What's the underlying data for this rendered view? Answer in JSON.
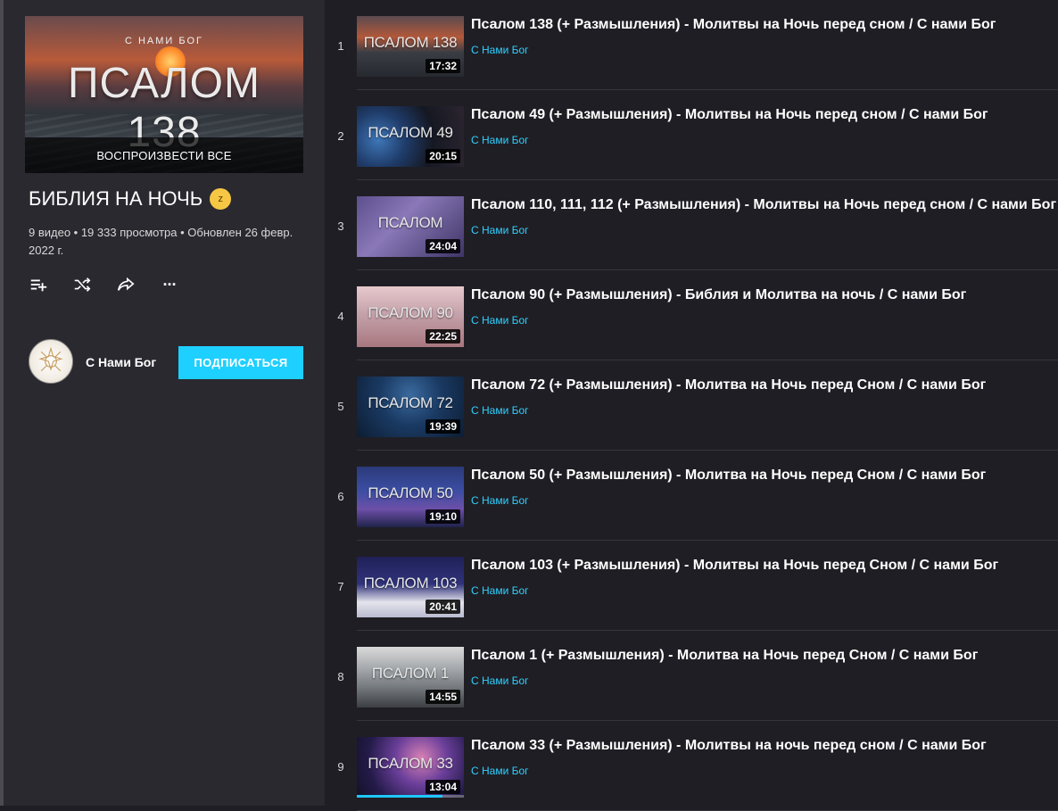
{
  "playlist": {
    "hero_brand": "С НАМИ БОГ",
    "hero_title": "ПСАЛОМ 138",
    "play_all_label": "ВОСПРОИЗВЕСТИ ВСЕ",
    "title": "БИБЛИЯ НА НОЧЬ",
    "title_emoji_icon": "sleeping-face-emoji",
    "meta": "9 видео • 19 333 просмотра • Обновлен 26 февр. 2022 г.",
    "actions": [
      {
        "name": "add-to-queue-icon"
      },
      {
        "name": "shuffle-icon"
      },
      {
        "name": "share-icon"
      },
      {
        "name": "more-icon",
        "glyph": "···"
      }
    ],
    "owner": {
      "name": "С Нами Бог",
      "subscribe_label": "ПОДПИСАТЬСЯ"
    }
  },
  "colors": {
    "accent": "#1ed0ff",
    "channel_link": "#2fd0ff",
    "sidebar_bg": "#2a2930",
    "list_bg": "#1f1e24"
  },
  "videos": [
    {
      "index": "1",
      "title": "Псалом 138 (+ Размышления) - Молитвы на Ночь перед сном / С нами Бог",
      "channel": "С Нами Бог",
      "duration": "17:32",
      "thumb_text": "ПСАЛОМ 138"
    },
    {
      "index": "2",
      "title": "Псалом 49 (+ Размышления) - Молитвы на Ночь перед сном / С нами Бог",
      "channel": "С Нами Бог",
      "duration": "20:15",
      "thumb_text": "ПСАЛОМ 49"
    },
    {
      "index": "3",
      "title": "Псалом 110, 111, 112 (+ Размышления) - Молитвы на Ночь перед сном / С нами Бог",
      "channel": "С Нами Бог",
      "duration": "24:04",
      "thumb_text": "ПСАЛОМ"
    },
    {
      "index": "4",
      "title": "Псалом 90 (+ Размышления) - Библия и Молитва на ночь / С нами Бог",
      "channel": "С Нами Бог",
      "duration": "22:25",
      "thumb_text": "ПСАЛОМ 90"
    },
    {
      "index": "5",
      "title": "Псалом 72 (+ Размышления) - Молитва на Ночь перед Сном / С нами Бог",
      "channel": "С Нами Бог",
      "duration": "19:39",
      "thumb_text": "ПСАЛОМ 72"
    },
    {
      "index": "6",
      "title": "Псалом 50 (+ Размышления) - Молитва на Ночь перед Сном / С нами Бог",
      "channel": "С Нами Бог",
      "duration": "19:10",
      "thumb_text": "ПСАЛОМ 50"
    },
    {
      "index": "7",
      "title": "Псалом 103 (+ Размышления) - Молитвы на Ночь перед Сном / С нами Бог",
      "channel": "С Нами Бог",
      "duration": "20:41",
      "thumb_text": "ПСАЛОМ 103"
    },
    {
      "index": "8",
      "title": "Псалом 1 (+ Размышления) - Молитва на Ночь перед Сном / С нами Бог",
      "channel": "С Нами Бог",
      "duration": "14:55",
      "thumb_text": "ПСАЛОМ 1"
    },
    {
      "index": "9",
      "title": "Псалом 33 (+ Размышления) - Молитвы на ночь перед сном / С нами Бог",
      "channel": "С Нами Бог",
      "duration": "13:04",
      "thumb_text": "ПСАЛОМ 33",
      "watched_fraction": 0.8
    }
  ]
}
